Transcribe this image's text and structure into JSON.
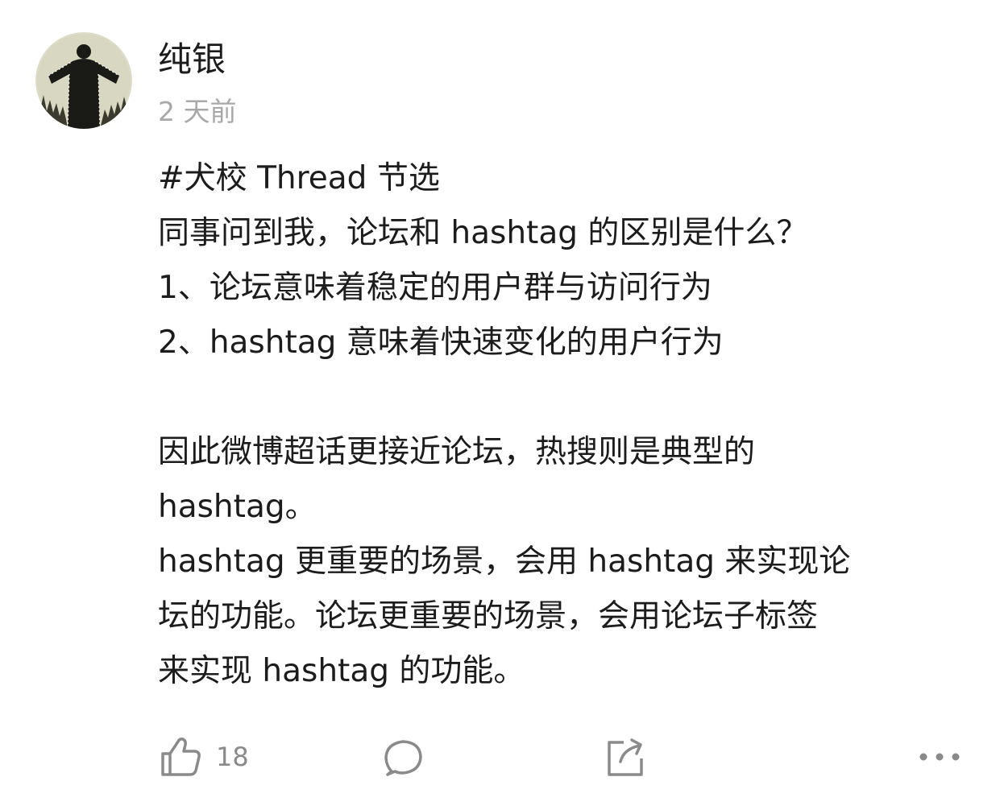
{
  "post": {
    "author": {
      "name": "纯银"
    },
    "time": "2 天前",
    "content_lines": [
      "#犬校 Thread 节选",
      "同事问到我，论坛和 hashtag 的区别是什么？",
      "1、论坛意味着稳定的用户群与访问行为",
      "2、hashtag 意味着快速变化的用户行为",
      "",
      "因此微博超话更接近论坛，热搜则是典型的",
      "hashtag。",
      "hashtag 更重要的场景，会用 hashtag 来实现论",
      "坛的功能。论坛更重要的场景，会用论坛子标签",
      "来实现 hashtag 的功能。"
    ]
  },
  "actions": {
    "like": {
      "icon": "thumbs-up-icon",
      "count": "18"
    },
    "comment": {
      "icon": "comment-bubble-icon"
    },
    "share": {
      "icon": "share-icon"
    },
    "more": {
      "icon": "more-dots-icon"
    }
  },
  "colors": {
    "text": "#1c1c1c",
    "secondary_text": "#a8a8a8",
    "icon": "#8a8a8a",
    "background": "#ffffff"
  }
}
